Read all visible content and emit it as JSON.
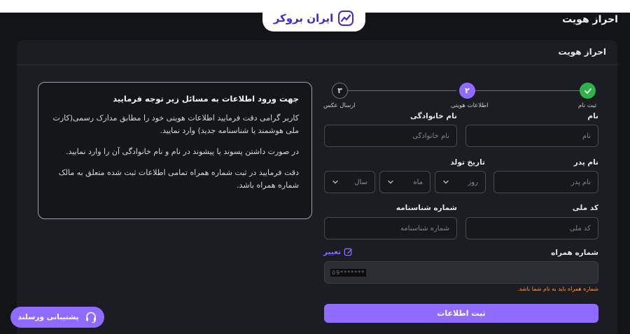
{
  "brand": {
    "name": "ایران بروکر",
    "color": "#3d2bd9"
  },
  "page": {
    "title": "احراز هویت"
  },
  "card": {
    "title": "احراز هویت"
  },
  "notice": {
    "title": "جهت ورود اطلاعات به مسائل زیر توجه فرمایید",
    "paragraphs": [
      "کاربر گرامی دقت فرمایید اطلاعات هویتی خود را مطابق مدارک رسمی(کارت ملی هوشمند یا شناسنامه جدید) وارد نمایید.",
      "در صورت داشتن پسوند یا پیشوند در نام و نام خانوادگی آن را وارد نمایید.",
      "دقت فرمایید در ثبت شماره همراه تمامی اطلاعات ثبت شده متعلق به مالک شماره همراه باشد."
    ]
  },
  "steps": [
    {
      "label": "ثبت نام",
      "state": "done",
      "icon": "check-icon",
      "color": "#2fb24a"
    },
    {
      "label": "اطلاعات هویتی",
      "number": "۲",
      "state": "active",
      "color": "#8f6cff"
    },
    {
      "label": "ارسال عکس",
      "number": "۳",
      "state": "pending"
    }
  ],
  "form": {
    "first_name": {
      "label": "نام",
      "placeholder": "نام"
    },
    "last_name": {
      "label": "نام خانوادگی",
      "placeholder": "نام خانوادگی"
    },
    "father_name": {
      "label": "نام پدر",
      "placeholder": "نام پدر"
    },
    "birth_date": {
      "label": "تاریخ تولد",
      "day": "روز",
      "month": "ماه",
      "year": "سال"
    },
    "national_code": {
      "label": "کد ملی",
      "placeholder": "کد ملی"
    },
    "id_number": {
      "label": "شماره شناسنامه",
      "placeholder": "شماره شناسنامه"
    },
    "phone": {
      "label": "شماره همراه",
      "value": "09*******",
      "change_label": "تغییر",
      "warning": "شماره همراه باید به نام شما باشد."
    },
    "submit_label": "ثبت اطلاعات"
  },
  "support": {
    "label": "پشتیبانی ورسلند",
    "icon": "headset-icon"
  },
  "colors": {
    "accent": "#8f6cff",
    "success": "#2fb24a",
    "warning": "#ff9d3a"
  }
}
